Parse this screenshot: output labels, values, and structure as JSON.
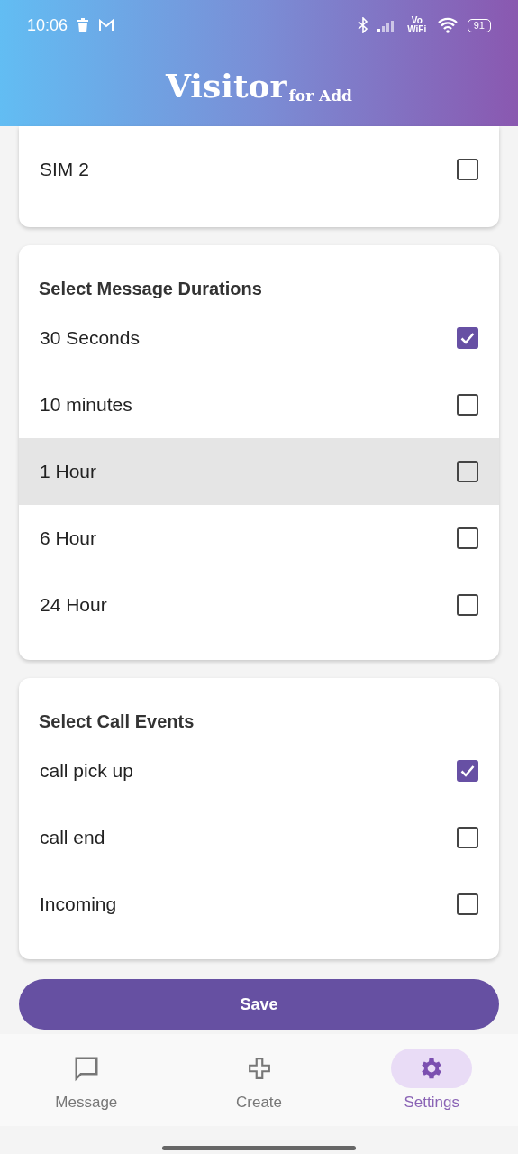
{
  "status_bar": {
    "time": "10:06",
    "network_label": "Vo WiFi",
    "battery": "91"
  },
  "header": {
    "title": "Visitor",
    "subtitle": "for Add"
  },
  "sections": [
    {
      "cut_top": true,
      "options": [
        {
          "label": "SIM 2",
          "checked": false,
          "highlighted": false
        }
      ]
    },
    {
      "title": "Select Message Durations",
      "cut_top": false,
      "options": [
        {
          "label": "30 Seconds",
          "checked": true,
          "highlighted": false
        },
        {
          "label": "10 minutes",
          "checked": false,
          "highlighted": false
        },
        {
          "label": "1 Hour",
          "checked": false,
          "highlighted": true
        },
        {
          "label": "6 Hour",
          "checked": false,
          "highlighted": false
        },
        {
          "label": "24 Hour",
          "checked": false,
          "highlighted": false
        }
      ]
    },
    {
      "title": "Select Call Events",
      "cut_top": false,
      "options": [
        {
          "label": "call pick up",
          "checked": true,
          "highlighted": false
        },
        {
          "label": "call end",
          "checked": false,
          "highlighted": false
        },
        {
          "label": "Incoming",
          "checked": false,
          "highlighted": false
        }
      ]
    }
  ],
  "save_button": "Save",
  "bottom_nav": [
    {
      "label": "Message",
      "kind": "message",
      "selected": false
    },
    {
      "label": "Create",
      "kind": "create",
      "selected": false
    },
    {
      "label": "Settings",
      "kind": "settings",
      "selected": true
    }
  ]
}
